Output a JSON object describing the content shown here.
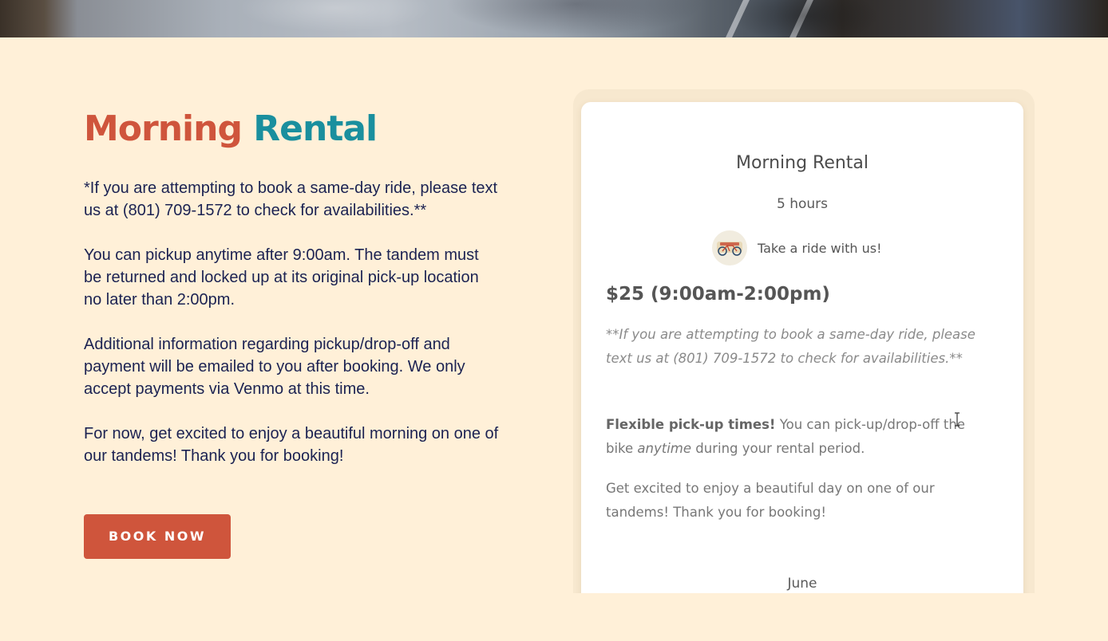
{
  "hero": {
    "image": "tandem-bike-photo"
  },
  "left": {
    "title_word1": "Morning",
    "title_word2": "Rental",
    "paragraphs": [
      "*If you are attempting to book a same-day ride, please text us at (801) 709-1572 to check for availabilities.**",
      "You can pickup anytime after 9:00am. The tandem must be returned and locked up at its original pick-up location no later than 2:00pm.",
      "Additional information regarding pickup/drop-off and payment will be emailed to you after booking. We only accept payments via Venmo at this time.",
      "For now, get excited to enjoy a beautiful morning on one of our tandems! Thank you for booking!"
    ],
    "book_button": "BOOK NOW"
  },
  "card": {
    "title": "Morning Rental",
    "duration": "5 hours",
    "provider_name": "Take a ride with us!",
    "price": "$25 (9:00am-2:00pm)",
    "note": "**If you are attempting to book a same-day ride, please text us at (801) 709-1572 to check for availabilities.**",
    "flex_bold": "Flexible pick-up times!",
    "flex_pre": " You can pick-up/drop-off the bike ",
    "flex_italic": "anytime",
    "flex_post": " during your rental period.",
    "excited": "Get excited to enjoy a beautiful day on one of our tandems! Thank you for booking!",
    "month": "June"
  },
  "colors": {
    "background": "#fff0d8",
    "accent_red": "#cf553c",
    "accent_teal": "#1a8f9e",
    "text_navy": "#1b2252"
  }
}
